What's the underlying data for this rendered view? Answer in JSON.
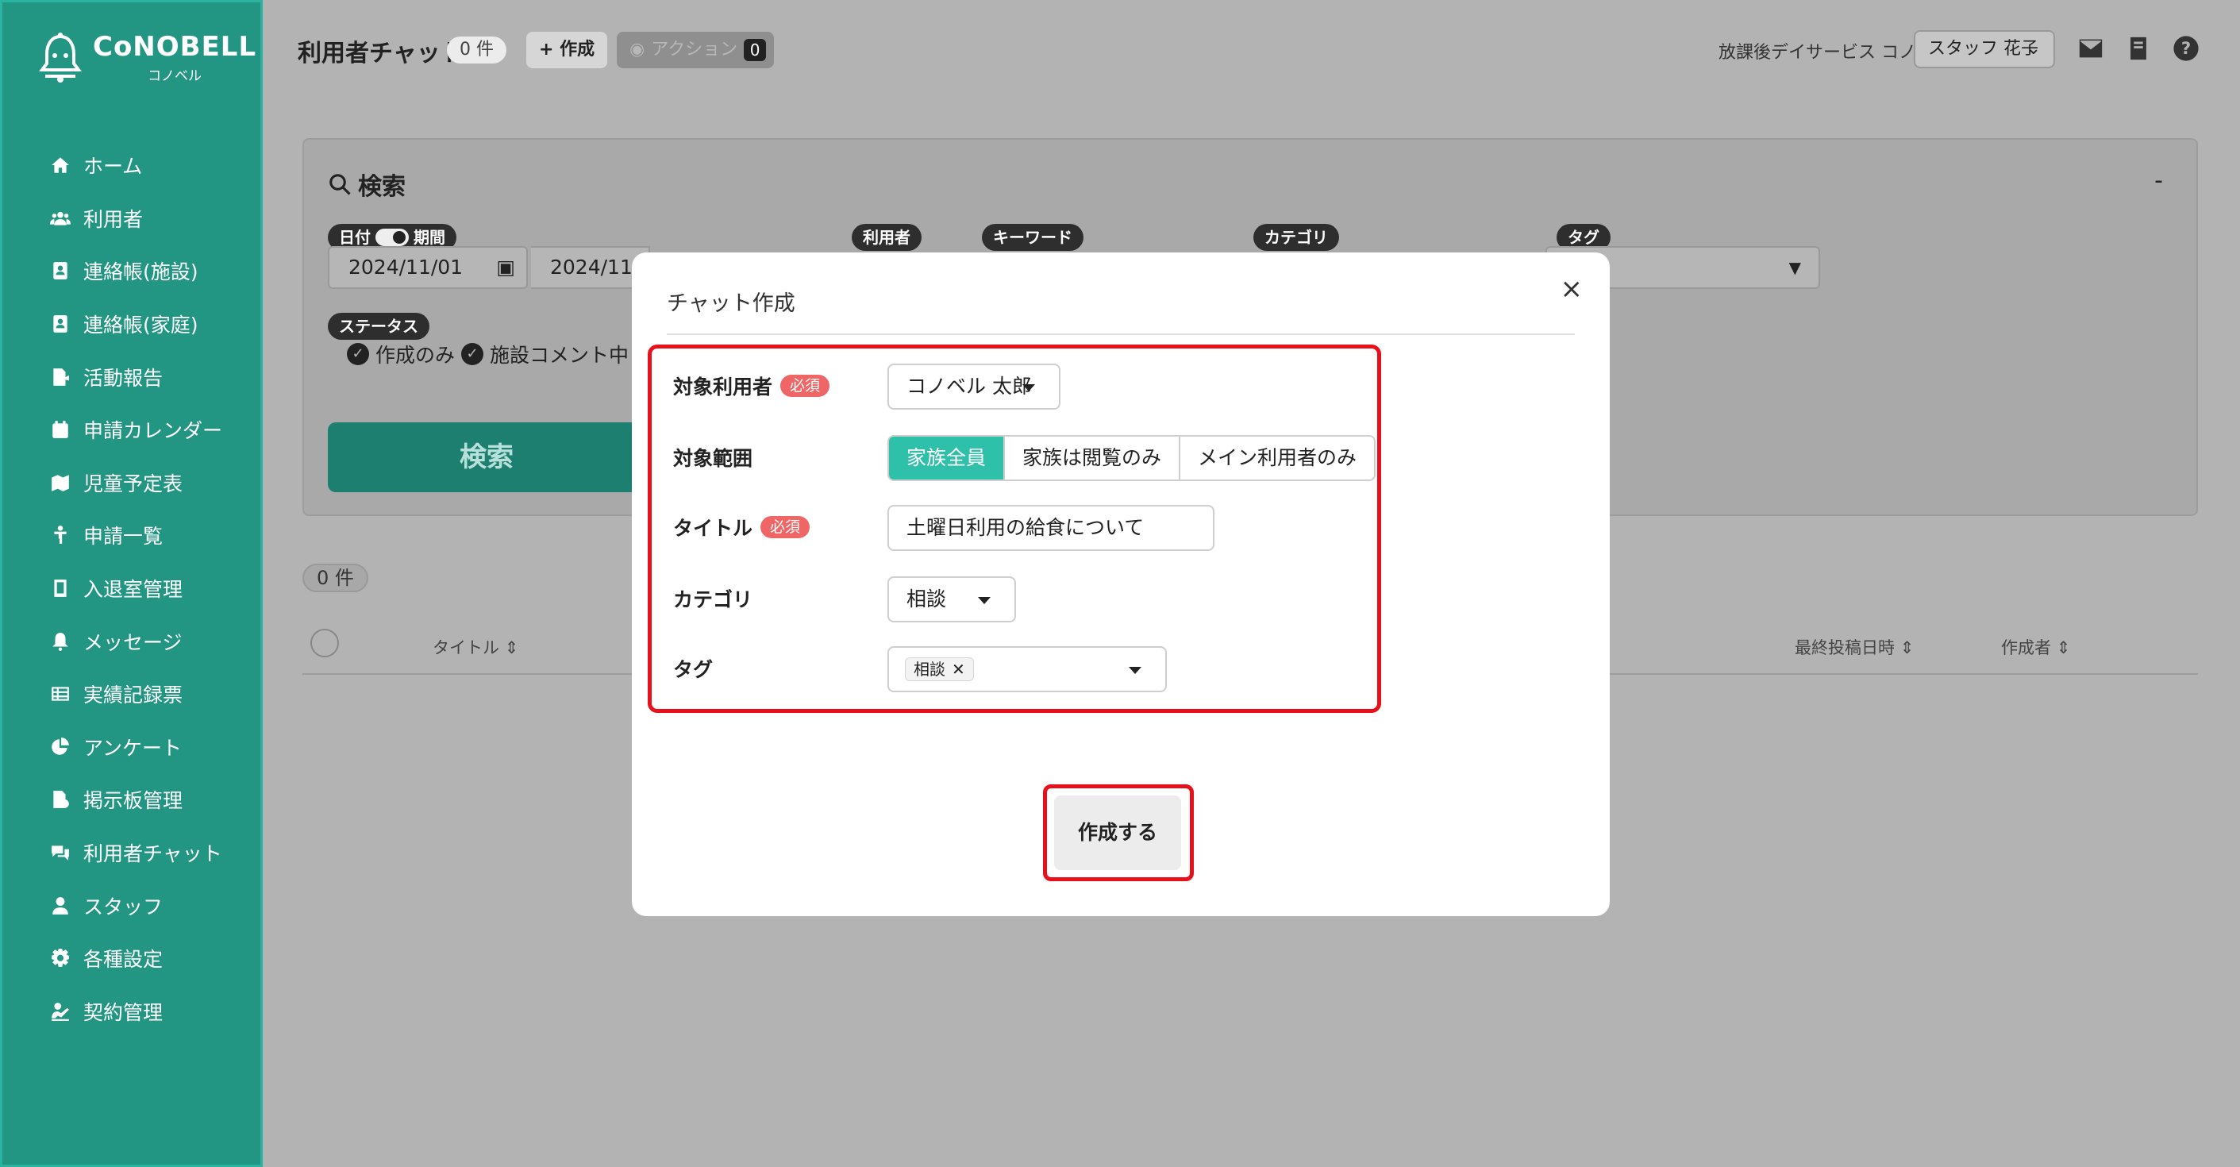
{
  "brand": {
    "name": "CoNOBELL",
    "sub": "コノベル"
  },
  "sidebar": {
    "items": [
      {
        "label": "ホーム",
        "icon": "home-icon"
      },
      {
        "label": "利用者",
        "icon": "users-icon"
      },
      {
        "label": "連絡帳(施設)",
        "icon": "contact-book-icon"
      },
      {
        "label": "連絡帳(家庭)",
        "icon": "contact-book-icon"
      },
      {
        "label": "活動報告",
        "icon": "report-icon"
      },
      {
        "label": "申請カレンダー",
        "icon": "calendar-icon"
      },
      {
        "label": "児童予定表",
        "icon": "schedule-icon"
      },
      {
        "label": "申請一覧",
        "icon": "child-icon"
      },
      {
        "label": "入退室管理",
        "icon": "tablet-icon"
      },
      {
        "label": "メッセージ",
        "icon": "bell-icon"
      },
      {
        "label": "実績記録票",
        "icon": "table-icon"
      },
      {
        "label": "アンケート",
        "icon": "pie-chart-icon"
      },
      {
        "label": "掲示板管理",
        "icon": "board-icon"
      },
      {
        "label": "利用者チャット",
        "icon": "chat-icon"
      },
      {
        "label": "スタッフ",
        "icon": "staff-icon"
      },
      {
        "label": "各種設定",
        "icon": "gear-icon"
      },
      {
        "label": "契約管理",
        "icon": "contract-icon"
      }
    ]
  },
  "header": {
    "title": "利用者チャット",
    "count": "0 件",
    "create_label": "作成",
    "action_label": "アクション",
    "action_count": "0",
    "facility": "放課後デイサービス コノベル",
    "staff": "スタッフ 花子"
  },
  "search": {
    "title": "検索",
    "collapse": "-",
    "date_label": "日付",
    "period_label": "期間",
    "date_from": "2024/11/01",
    "date_sep": "~",
    "date_to": "2024/11/",
    "user_label": "利用者",
    "keyword_label": "キーワード",
    "category_label": "カテゴリ",
    "tag_label": "タグ",
    "status_label": "ステータス",
    "statuses": [
      "作成のみ",
      "施設コメント中"
    ],
    "button": "検索"
  },
  "results": {
    "count": "0 件",
    "columns": {
      "title": "タイトル",
      "last_post": "最終投稿日時",
      "author": "作成者"
    }
  },
  "modal": {
    "title": "チャット作成",
    "close": "×",
    "fields": {
      "target_user": {
        "label": "対象利用者",
        "required": "必須",
        "value": "コノベル 太郎"
      },
      "scope": {
        "label": "対象範囲",
        "options": [
          "家族全員",
          "家族は閲覧のみ",
          "メイン利用者のみ"
        ],
        "selected": "家族全員"
      },
      "title": {
        "label": "タイトル",
        "required": "必須",
        "value": "土曜日利用の給食について"
      },
      "category": {
        "label": "カテゴリ",
        "value": "相談"
      },
      "tag": {
        "label": "タグ",
        "chip": "相談",
        "chip_remove": "✕"
      }
    },
    "submit": "作成する"
  },
  "colors": {
    "sidebar": "#229683",
    "accent": "#2fc0aa",
    "highlight": "#e8101a",
    "required": "#f06565"
  }
}
